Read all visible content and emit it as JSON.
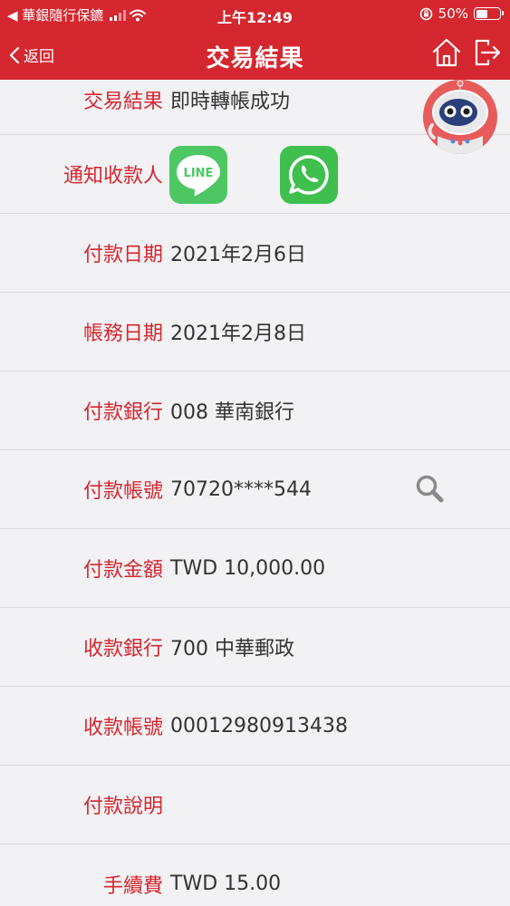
{
  "status_bar": {
    "carrier": "◀ 華銀隨行保鑣",
    "time": "上午12:49",
    "battery_percent": "50%",
    "battery_level": 0.5
  },
  "nav": {
    "back_label": "返回",
    "title": "交易結果",
    "icons": [
      "home-icon",
      "logout-icon"
    ]
  },
  "result": {
    "label": "交易結果",
    "value": "即時轉帳成功"
  },
  "notify": {
    "label": "通知收款人",
    "line_text": "LINE",
    "apps": [
      "line-icon",
      "whatsapp-icon"
    ]
  },
  "details": [
    {
      "label": "付款日期",
      "value": "2021年2月6日"
    },
    {
      "label": "帳務日期",
      "value": "2021年2月8日"
    },
    {
      "label": "付款銀行",
      "value": "008 華南銀行"
    },
    {
      "label": "付款帳號",
      "value": "70720****544"
    },
    {
      "label": "付款金額",
      "value": "TWD 10,000.00"
    },
    {
      "label": "收款銀行",
      "value": "700 中華郵政"
    },
    {
      "label": "收款帳號",
      "value": "00012980913438"
    },
    {
      "label": "付款說明",
      "value": ""
    },
    {
      "label": "手續費",
      "value": "TWD 15.00"
    }
  ],
  "colors": {
    "brand_red": "#d5272f",
    "line_green": "#4cc764",
    "whatsapp_green": "#3fbf4d",
    "text": "#333333",
    "divider": "#dadadc",
    "background": "#f2f2f4"
  }
}
